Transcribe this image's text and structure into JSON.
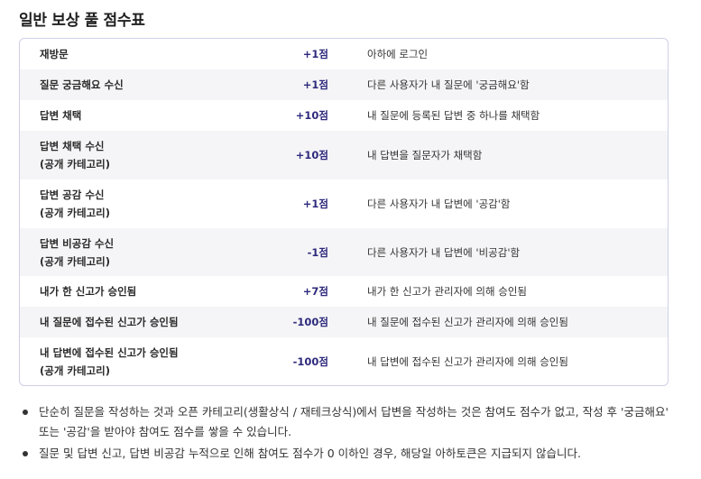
{
  "title": "일반 보상 풀 점수표",
  "rows": [
    {
      "name": [
        "재방문"
      ],
      "points": "+1점",
      "desc": "아하에 로그인"
    },
    {
      "name": [
        "질문 궁금해요 수신"
      ],
      "points": "+1점",
      "desc": "다른 사용자가 내 질문에 '궁금해요'함"
    },
    {
      "name": [
        "답변 채택"
      ],
      "points": "+10점",
      "desc": "내 질문에 등록된 답변 중 하나를 채택함"
    },
    {
      "name": [
        "답변 채택 수신",
        "(공개 카테고리)"
      ],
      "points": "+10점",
      "desc": "내 답변을 질문자가 채택함"
    },
    {
      "name": [
        "답변 공감 수신",
        "(공개 카테고리)"
      ],
      "points": "+1점",
      "desc": "다른 사용자가 내 답변에 '공감'함"
    },
    {
      "name": [
        "답변 비공감 수신",
        "(공개 카테고리)"
      ],
      "points": "-1점",
      "desc": "다른 사용자가 내 답변에 '비공감'함"
    },
    {
      "name": [
        "내가 한 신고가 승인됨"
      ],
      "points": "+7점",
      "desc": "내가 한 신고가 관리자에 의해 승인됨"
    },
    {
      "name": [
        "내 질문에 접수된 신고가 승인됨"
      ],
      "points": "-100점",
      "desc": "내 질문에 접수된 신고가 관리자에 의해 승인됨"
    },
    {
      "name": [
        "내 답변에 접수된 신고가 승인됨",
        "(공개 카테고리)"
      ],
      "points": "-100점",
      "desc": "내 답변에 접수된 신고가 관리자에 의해 승인됨"
    }
  ],
  "notes": [
    "단순히 질문을 작성하는 것과 오픈 카테고리(생활상식 / 재테크상식)에서 답변을 작성하는 것은 참여도 점수가 없고, 작성 후 '궁금해요' 또는 '공감'을 받아야 참여도 점수를 쌓을 수 있습니다.",
    "질문 및 답변 신고, 답변 비공감 누적으로 인해 참여도 점수가 0 이하인 경우, 해당일 아하토큰은 지급되지 않습니다."
  ]
}
